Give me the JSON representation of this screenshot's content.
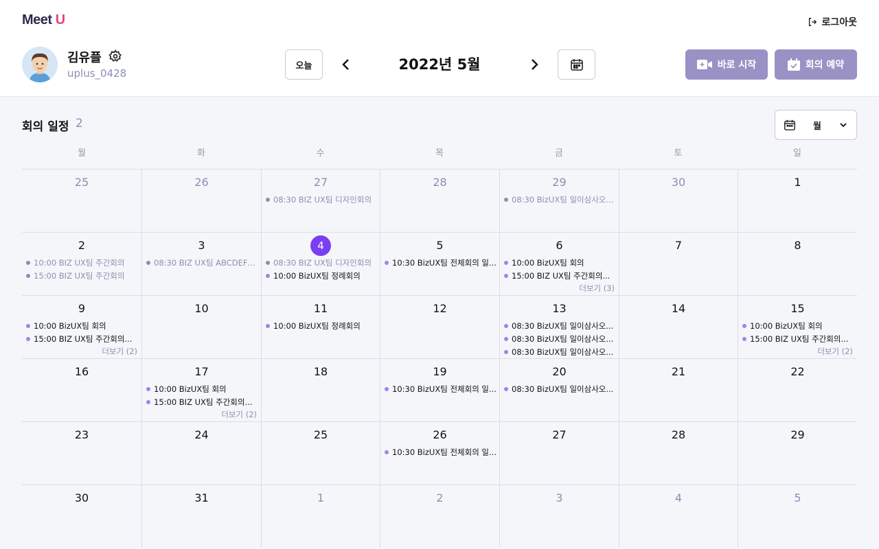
{
  "header": {
    "logo": {
      "meet": "Meet",
      "u": "U"
    },
    "logout_label": "로그아웃",
    "user": {
      "name": "김유플",
      "id": "uplus_0428"
    },
    "today_label": "오늘",
    "month_title": "2022년 5월",
    "start_label": "바로 시작",
    "reserve_label": "회의 예약"
  },
  "section": {
    "title": "회의 일정",
    "count": "2",
    "view_label": "월"
  },
  "weekdays": [
    "월",
    "화",
    "수",
    "목",
    "금",
    "토",
    "일"
  ],
  "colors": {
    "accent": "#7b3ff2",
    "button": "#9a91c4",
    "muted": "#8a8fb0",
    "event_dot": "#a780e8"
  },
  "weeks": [
    [
      {
        "day": "25",
        "other": true,
        "events": []
      },
      {
        "day": "26",
        "other": true,
        "events": []
      },
      {
        "day": "27",
        "other": true,
        "events": [
          {
            "text": "08:30 BIZ UX팀 디자인회의",
            "past": true
          }
        ]
      },
      {
        "day": "28",
        "other": true,
        "events": []
      },
      {
        "day": "29",
        "other": true,
        "events": [
          {
            "text": "08:30 BizUX팀 일이삼사오...",
            "past": true
          }
        ]
      },
      {
        "day": "30",
        "other": true,
        "events": []
      },
      {
        "day": "1",
        "other": false,
        "events": []
      }
    ],
    [
      {
        "day": "2",
        "events": [
          {
            "text": "10:00 BIZ UX팀 주간회의",
            "past": true
          },
          {
            "text": "15:00 BIZ UX팀 주간회의",
            "past": true
          }
        ]
      },
      {
        "day": "3",
        "events": [
          {
            "text": "08:30 BIZ UX팀 ABCDEFG...",
            "past": true
          }
        ]
      },
      {
        "day": "4",
        "today": true,
        "events": [
          {
            "text": "08:30 BIZ UX팀 디자인회의",
            "past": true
          },
          {
            "text": "10:00 BizUX팀 정례회의",
            "past": false
          }
        ]
      },
      {
        "day": "5",
        "events": [
          {
            "text": "10:30 BizUX팀 전체회의 일...",
            "past": false
          }
        ]
      },
      {
        "day": "6",
        "events": [
          {
            "text": "10:00 BizUX팀 회의",
            "past": false
          },
          {
            "text": "15:00 BIZ UX팀 주간회의...",
            "past": false
          }
        ],
        "more": "더보기 (3)"
      },
      {
        "day": "7",
        "events": []
      },
      {
        "day": "8",
        "events": []
      }
    ],
    [
      {
        "day": "9",
        "events": [
          {
            "text": "10:00 BizUX팀 회의",
            "past": false
          },
          {
            "text": "15:00 BIZ UX팀 주간회의...",
            "past": false
          }
        ],
        "more": "더보기 (2)"
      },
      {
        "day": "10",
        "events": []
      },
      {
        "day": "11",
        "events": [
          {
            "text": "10:00 BizUX팀 정례회의",
            "past": false
          }
        ]
      },
      {
        "day": "12",
        "events": []
      },
      {
        "day": "13",
        "events": [
          {
            "text": "08:30 BizUX팀 일이삼사오...",
            "past": false
          },
          {
            "text": "08:30 BizUX팀 일이삼사오...",
            "past": false
          },
          {
            "text": "08:30 BizUX팀 일이삼사오...",
            "past": false
          }
        ]
      },
      {
        "day": "14",
        "events": []
      },
      {
        "day": "15",
        "events": [
          {
            "text": "10:00 BizUX팀 회의",
            "past": false
          },
          {
            "text": "15:00 BIZ UX팀 주간회의...",
            "past": false
          }
        ],
        "more": "더보기 (2)"
      }
    ],
    [
      {
        "day": "16",
        "events": []
      },
      {
        "day": "17",
        "events": [
          {
            "text": "10:00 BizUX팀 회의",
            "past": false
          },
          {
            "text": "15:00 BIZ UX팀 주간회의...",
            "past": false
          }
        ],
        "more": "더보기 (2)"
      },
      {
        "day": "18",
        "events": []
      },
      {
        "day": "19",
        "events": [
          {
            "text": "10:30 BizUX팀 전체회의 일...",
            "past": false
          }
        ]
      },
      {
        "day": "20",
        "events": [
          {
            "text": "08:30 BizUX팀 일이삼사오...",
            "past": false
          }
        ]
      },
      {
        "day": "21",
        "events": []
      },
      {
        "day": "22",
        "events": []
      }
    ],
    [
      {
        "day": "23",
        "events": []
      },
      {
        "day": "24",
        "events": []
      },
      {
        "day": "25",
        "events": []
      },
      {
        "day": "26",
        "events": [
          {
            "text": "10:30 BizUX팀 전체회의 일...",
            "past": false
          }
        ]
      },
      {
        "day": "27",
        "events": []
      },
      {
        "day": "28",
        "events": []
      },
      {
        "day": "29",
        "events": []
      }
    ],
    [
      {
        "day": "30",
        "events": []
      },
      {
        "day": "31",
        "events": []
      },
      {
        "day": "1",
        "other": true,
        "events": []
      },
      {
        "day": "2",
        "other": true,
        "events": []
      },
      {
        "day": "3",
        "other": true,
        "events": []
      },
      {
        "day": "4",
        "other": true,
        "events": []
      },
      {
        "day": "5",
        "other": true,
        "events": []
      }
    ]
  ]
}
